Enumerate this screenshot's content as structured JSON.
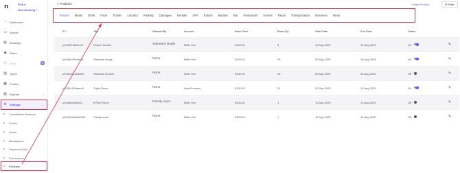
{
  "brand": {
    "mark": "n",
    "pos": "POS ▸",
    "new_booking": "New Booking +"
  },
  "sidebar": {
    "items": [
      {
        "label": "Dashboard",
        "icon": "◔"
      },
      {
        "label": "Rooms",
        "icon": "▭"
      },
      {
        "label": "Bookings",
        "icon": "▤"
      },
      {
        "label": "Rates",
        "icon": "◉"
      },
      {
        "label": "Inbox",
        "icon": "✉",
        "badge": "8"
      },
      {
        "label": "Types",
        "icon": "▥"
      },
      {
        "label": "Profiles",
        "icon": "▦"
      },
      {
        "label": "Reports",
        "icon": "▨"
      },
      {
        "label": "Settings",
        "icon": "⚙"
      }
    ],
    "subitems": [
      "Cancellation Reasons",
      "Emails",
      "Hotels",
      "Marketplace",
      "Payment Rules",
      "Permissions",
      "Products"
    ]
  },
  "header": {
    "back": "< Products",
    "new_product": "+ New Product",
    "filter": "☰ Filter"
  },
  "tabs": [
    "Rooms",
    "Meals",
    "Drink",
    "Food",
    "Tickets",
    "Laundry",
    "Parking",
    "Damages",
    "Rentals",
    "SPA",
    "Extra's",
    "Minibar",
    "Bar",
    "Restaurant",
    "Events",
    "Retail",
    "Transportation",
    "Business",
    "Items"
  ],
  "table": {
    "headers": [
      "ID ↑",
      "Title",
      "Affected By",
      "Account",
      "Base Price",
      "Base Qty",
      "Start Date",
      "End Date",
      "Status"
    ],
    "rows": [
      {
        "id": "p40d9f73b0ec03",
        "title": "Deluxe Double",
        "affected": "Standard single",
        "account": "Belle Vue",
        "price": "€420.00",
        "qty": "3",
        "start": "12 Aug 2025",
        "end": "13 Aug 2025",
        "status": "On"
      },
      {
        "id": "p40dbd7ff14ee4f",
        "title": "Standard single",
        "affected": "None",
        "account": "Belle Vue",
        "price": "€420.00",
        "qty": "26",
        "start": "05 Aug 2025",
        "end": "18 Aug 2025",
        "status": "On"
      },
      {
        "id": "p400bc0ea068b0",
        "title": "Standard Double",
        "affected": "None",
        "account": "Belle Vue",
        "price": "€300.00",
        "qty": "25",
        "start": "05 Aug 2025",
        "end": "05 Aug 2025",
        "status": "Off"
      },
      {
        "id": "p4082c13f4aee4f",
        "title": "Triple Room",
        "affected": "None",
        "account": "HotelConnect",
        "price": "€120.00",
        "qty": "21",
        "start": "01 Sep 2024",
        "end": "12 Aug 2025",
        "status": "On"
      },
      {
        "id": "p40a89e606b01",
        "title": "8 PAX Room",
        "affected": "Family room",
        "account": "Belle Vue",
        "price": "€300.00",
        "qty": "1",
        "start": "12 Aug 2025",
        "end": "13 Aug 2025",
        "status": "Off"
      },
      {
        "id": "p40d422bda0b34d",
        "title": "Family room",
        "affected": "None",
        "account": "Belle Vue",
        "price": "€300.00",
        "qty": "1",
        "start": "12 Aug 2025",
        "end": "13 Aug 2025",
        "status": "Off"
      }
    ]
  },
  "colors": {
    "accent": "#6a4cf2",
    "highlight": "#e0354a"
  }
}
